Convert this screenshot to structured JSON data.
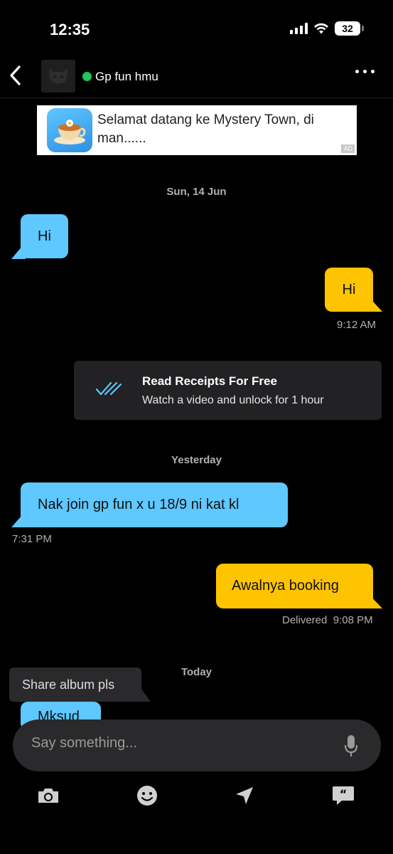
{
  "status_bar": {
    "time": "12:35",
    "battery": "32"
  },
  "header": {
    "title": "Gp fun hmu"
  },
  "ad": {
    "text": "Selamat datang ke Mystery Town, di man......",
    "badge": "AD"
  },
  "messages": {
    "day1": "Sun, 14 Jun",
    "m1": "Hi",
    "m2": "Hi",
    "m2_time": "9:12 AM",
    "receipt_title": "Read Receipts For Free",
    "receipt_sub": "Watch a video and unlock for 1 hour",
    "day2": "Yesterday",
    "m3": "Nak join gp fun x u 18/9 ni kat kl",
    "m3_time": "7:31 PM",
    "m4": "Awalnya booking",
    "m4_status": "Delivered",
    "m4_time": "9:08 PM",
    "day3": "Today",
    "m5": "Mksud"
  },
  "tooltip": {
    "text": "Share album pls"
  },
  "composer": {
    "placeholder": "Say something..."
  },
  "colors": {
    "incoming": "#5ec8ff",
    "outgoing": "#ffc400",
    "online": "#22c55e"
  },
  "icons": [
    "camera-icon",
    "emoji-icon",
    "location-icon",
    "quick-reply-icon",
    "microphone-icon"
  ]
}
